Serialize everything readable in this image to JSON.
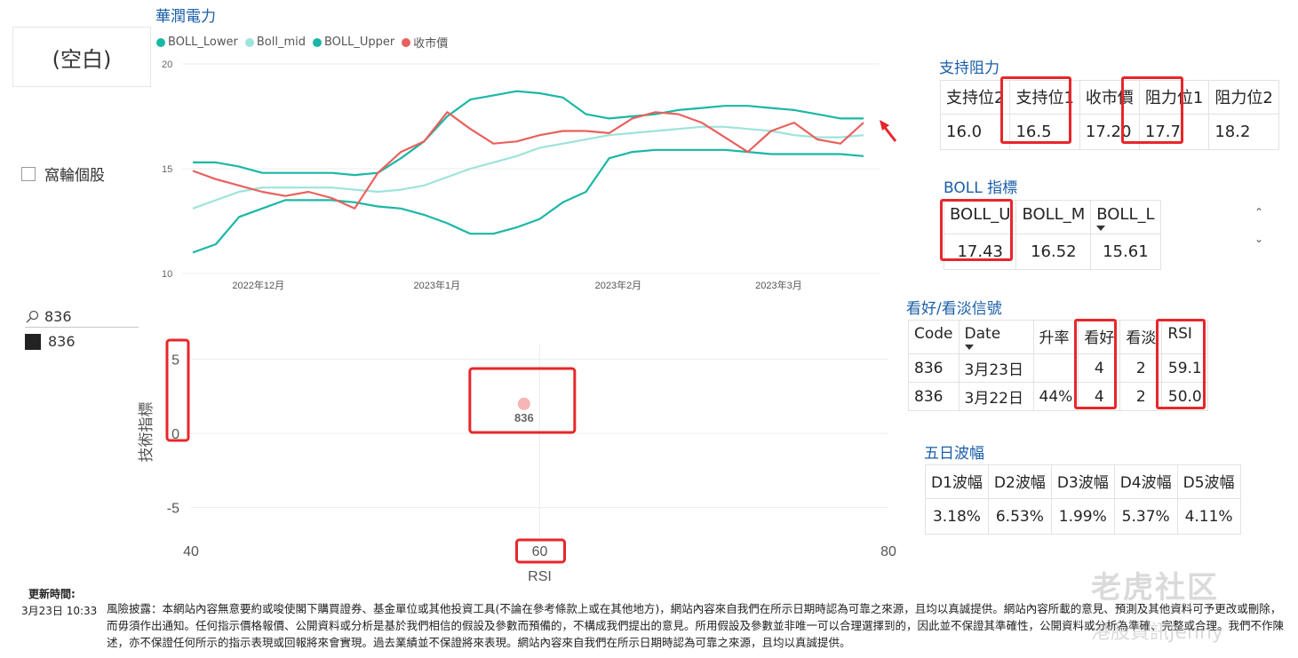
{
  "slicer": {
    "value": "(空白)"
  },
  "checkbox": {
    "label": "窩輪個股"
  },
  "search": {
    "query": "836",
    "item": "836"
  },
  "chart_title": "華潤電力",
  "chart_data": [
    {
      "type": "line",
      "title": "華潤電力",
      "ylim": [
        10,
        20
      ],
      "yticks": [
        "20",
        "15",
        "10"
      ],
      "xticks": [
        "2022年12月",
        "2023年1月",
        "2023年2月",
        "2023年3月"
      ],
      "series": [
        {
          "name": "BOLL_Lower",
          "color": "#1ab7a6",
          "values": [
            11.0,
            11.4,
            12.7,
            13.1,
            13.5,
            13.5,
            13.5,
            13.4,
            13.2,
            13.1,
            12.8,
            12.4,
            11.9,
            11.9,
            12.2,
            12.6,
            13.4,
            13.9,
            15.5,
            15.8,
            15.9,
            15.9,
            15.9,
            15.9,
            15.8,
            15.7,
            15.7,
            15.7,
            15.7,
            15.6
          ]
        },
        {
          "name": "Boll_mid",
          "color": "#9de4db",
          "values": [
            13.1,
            13.5,
            13.9,
            14.1,
            14.1,
            14.1,
            14.1,
            14.0,
            13.9,
            14.0,
            14.2,
            14.6,
            15.0,
            15.3,
            15.6,
            16.0,
            16.2,
            16.4,
            16.6,
            16.7,
            16.8,
            16.9,
            17.0,
            17.0,
            16.9,
            16.8,
            16.6,
            16.5,
            16.5,
            16.6
          ]
        },
        {
          "name": "BOLL_Upper",
          "color": "#1ab7a6",
          "values": [
            15.3,
            15.3,
            15.1,
            14.8,
            14.8,
            14.8,
            14.8,
            14.7,
            14.8,
            15.5,
            16.3,
            17.5,
            18.3,
            18.5,
            18.7,
            18.6,
            18.4,
            17.6,
            17.4,
            17.5,
            17.6,
            17.8,
            17.9,
            18.0,
            18.0,
            17.9,
            17.8,
            17.6,
            17.4,
            17.4
          ]
        },
        {
          "name": "收市價",
          "color": "#e8615e",
          "values": [
            14.9,
            14.5,
            14.2,
            13.9,
            13.7,
            13.9,
            13.6,
            13.1,
            14.8,
            15.8,
            16.3,
            17.7,
            16.9,
            16.2,
            16.3,
            16.6,
            16.8,
            16.8,
            16.7,
            17.4,
            17.7,
            17.6,
            17.2,
            16.5,
            15.8,
            16.8,
            17.2,
            16.4,
            16.2,
            17.2
          ]
        }
      ]
    },
    {
      "type": "scatter",
      "xlabel": "RSI",
      "ylabel": "技術指標",
      "xlim": [
        40,
        80
      ],
      "ylim": [
        -7,
        6
      ],
      "xticks": [
        "40",
        "60",
        "80"
      ],
      "yticks": [
        "5",
        "0",
        "-5"
      ],
      "points": [
        {
          "x": 59.1,
          "y": 2.0,
          "label": "836"
        }
      ]
    }
  ],
  "support_table": {
    "title": "支持阻力",
    "headers": [
      "支持位2",
      "支持位1",
      "收市價",
      "阻力位1",
      "阻力位2"
    ],
    "values": [
      "16.0",
      "16.5",
      "17.20",
      "17.7",
      "18.2"
    ]
  },
  "boll_table": {
    "title": "BOLL 指標",
    "headers": [
      "BOLL_U",
      "BOLL_M",
      "BOLL_L"
    ],
    "values": [
      "17.43",
      "16.52",
      "15.61"
    ]
  },
  "signal_table": {
    "title": "看好/看淡信號",
    "headers": [
      "Code",
      "Date",
      "升率",
      "看好",
      "看淡",
      "RSI"
    ],
    "rows": [
      [
        "836",
        "3月23日",
        "",
        "4",
        "2",
        "59.1"
      ],
      [
        "836",
        "3月22日",
        "44%",
        "4",
        "2",
        "50.0"
      ]
    ]
  },
  "wave_table": {
    "title": "五日波幅",
    "headers": [
      "D1波幅",
      "D2波幅",
      "D3波幅",
      "D4波幅",
      "D5波幅"
    ],
    "values": [
      "3.18%",
      "6.53%",
      "1.99%",
      "5.37%",
      "4.11%"
    ]
  },
  "footer": {
    "update_label": "更新時間:",
    "update_time": "3月23日 10:33",
    "disclaimer": "風險披露：本網站內容無意要約或唆使閣下購買證券、基金單位或其他投資工具(不論在參考條款上或在其他地方)，網站內容來自我們在所示日期時認為可靠之來源，且均以真誠提供。網站內容所載的意見、預測及其他資料可予更改或刪除，而毋須作出通知。任何指示價格報價、公開資料或分析是基於我們相信的假設及參數而預備的，不構成我們提出的意見。所用假設及參數並非唯一可以合理選擇到的，因此並不保證其準確性，公開資料或分析為準確、完整或合理。我們不作陳述，亦不保證任何所示的指示表現或回報將來會實現。過去業績並不保證將來表現。網站內容來自我們在所示日期時認為可靠之來源，且均以真誠提供。"
  },
  "watermark": {
    "line1": "老虎社区",
    "line2": "港股資訊Jenny"
  }
}
